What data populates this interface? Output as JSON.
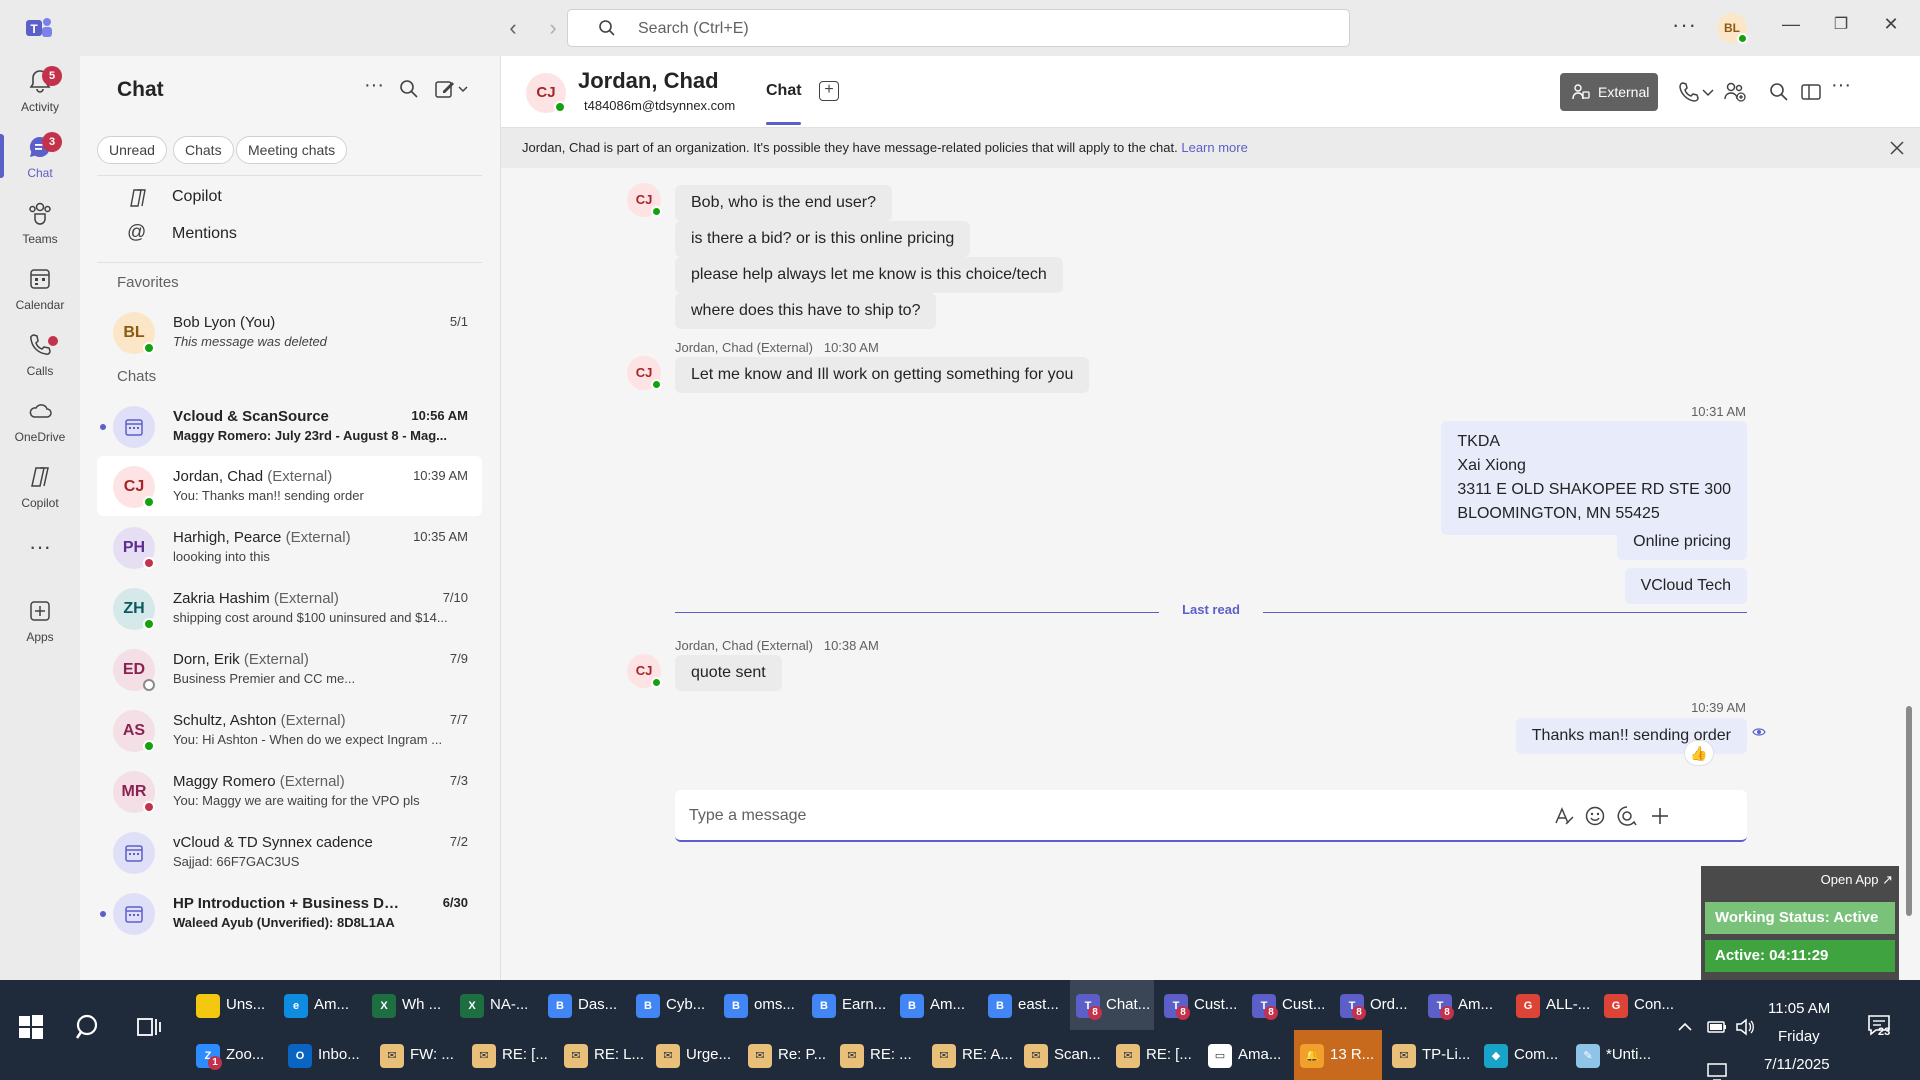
{
  "titlebar": {
    "search_placeholder": "Search (Ctrl+E)",
    "avatar_initials": "BL"
  },
  "rail": {
    "items": [
      {
        "label": "Activity",
        "badge": "5"
      },
      {
        "label": "Chat",
        "badge": "3"
      },
      {
        "label": "Teams"
      },
      {
        "label": "Calendar"
      },
      {
        "label": "Calls"
      },
      {
        "label": "OneDrive"
      },
      {
        "label": "Copilot"
      },
      {
        "label": "Apps"
      }
    ]
  },
  "chatlist": {
    "title": "Chat",
    "filters": [
      "Unread",
      "Chats",
      "Meeting chats"
    ],
    "links": [
      "Copilot",
      "Mentions"
    ],
    "favorites_label": "Favorites",
    "chats_label": "Chats",
    "favorites": [
      {
        "initials": "BL",
        "name": "Bob Lyon (You)",
        "preview": "This message was deleted",
        "time": "5/1"
      }
    ],
    "chats": [
      {
        "name": "Vcloud & ScanSource",
        "preview": "Maggy Romero: July 23rd - August 8 - Mag...",
        "time": "10:56 AM",
        "unread": true,
        "meeting": true
      },
      {
        "initials": "CJ",
        "name": "Jordan, Chad",
        "ext": "(External)",
        "preview": "You: Thanks man!! sending order",
        "time": "10:39 AM"
      },
      {
        "initials": "PH",
        "name": "Harhigh, Pearce",
        "ext": "(External)",
        "preview": "loooking into this",
        "time": "10:35 AM"
      },
      {
        "initials": "ZH",
        "name": "Zakria Hashim",
        "ext": "(External)",
        "preview": "shipping cost around $100 uninsured and $14...",
        "time": "7/10"
      },
      {
        "initials": "ED",
        "name": "Dorn, Erik",
        "ext": "(External)",
        "preview": "Business Premier and CC me...",
        "time": "7/9"
      },
      {
        "initials": "AS",
        "name": "Schultz, Ashton",
        "ext": "(External)",
        "preview": "You: Hi Ashton -  When do we expect Ingram ...",
        "time": "7/7"
      },
      {
        "initials": "MR",
        "name": "Maggy Romero",
        "ext": "(External)",
        "preview": "You: Maggy we are waiting for the VPO pls",
        "time": "7/3"
      },
      {
        "name": "vCloud & TD Synnex cadence",
        "preview": "Sajjad: 66F7GAC3US",
        "time": "7/2",
        "meeting": true
      },
      {
        "name": "HP Introduction + Business Dis...",
        "preview": "Waleed Ayub (Unverified): 8D8L1AA",
        "time": "6/30",
        "unread": true,
        "meeting": true
      }
    ]
  },
  "header": {
    "initials": "CJ",
    "name": "Jordan, Chad",
    "email": "t484086m@tdsynnex.com",
    "tab": "Chat",
    "external_label": "External"
  },
  "notice": {
    "text": "Jordan, Chad is part of an organization. It's possible they have message-related policies that will apply to the chat. ",
    "link": "Learn more"
  },
  "messages": {
    "incoming_1": [
      "Bob, who is the end user?",
      "is there a bid? or is this online pricing",
      "please help always let me know is this choice/tech",
      "where does this have to ship to?"
    ],
    "meta_2": "Jordan, Chad (External)   10:30 AM",
    "incoming_2": "Let me know and Ill work on getting something for you",
    "out_time_1": "10:31 AM",
    "address": [
      "TKDA",
      "Xai Xiong",
      "3311 E OLD SHAKOPEE RD STE 300",
      "BLOOMINGTON, MN 55425"
    ],
    "out_2": "Online pricing",
    "out_3": "VCloud Tech",
    "last_read": "Last read",
    "meta_3": "Jordan, Chad (External)   10:38 AM",
    "incoming_3": "quote sent",
    "out_time_2": "10:39 AM",
    "out_4": "Thanks man!! sending order",
    "reaction": "👍"
  },
  "compose": {
    "placeholder": "Type a message"
  },
  "widget": {
    "open_app": "Open App ↗",
    "status": "Working Status: Active",
    "active": "Active: 04:11:29"
  },
  "taskbar": {
    "row1": [
      {
        "label": "Uns...",
        "color": "#f2c811",
        "glyph": ""
      },
      {
        "label": "Am...",
        "color": "#0f8be0",
        "glyph": "e"
      },
      {
        "label": "Wh ...",
        "color": "#1d6f42",
        "glyph": "X"
      },
      {
        "label": "NA-...",
        "color": "#1d6f42",
        "glyph": "X"
      },
      {
        "label": "Das...",
        "color": "#4285f4",
        "glyph": "B"
      },
      {
        "label": "Cyb...",
        "color": "#4285f4",
        "glyph": "B"
      },
      {
        "label": "oms...",
        "color": "#4285f4",
        "glyph": "B"
      },
      {
        "label": "Earn...",
        "color": "#4285f4",
        "glyph": "B"
      },
      {
        "label": "Am...",
        "color": "#4285f4",
        "glyph": "B"
      },
      {
        "label": "east...",
        "color": "#4285f4",
        "glyph": "B"
      },
      {
        "label": "Chat...",
        "color": "#5b5fc7",
        "glyph": "T",
        "badge": "8",
        "active": true
      },
      {
        "label": "Cust...",
        "color": "#5b5fc7",
        "glyph": "T",
        "badge": "8"
      },
      {
        "label": "Cust...",
        "color": "#5b5fc7",
        "glyph": "T",
        "badge": "8"
      },
      {
        "label": "Ord...",
        "color": "#5b5fc7",
        "glyph": "T",
        "badge": "8"
      },
      {
        "label": "Am...",
        "color": "#5b5fc7",
        "glyph": "T",
        "badge": "8"
      },
      {
        "label": "ALL-...",
        "color": "#db4437",
        "glyph": "G"
      },
      {
        "label": "Con...",
        "color": "#db4437",
        "glyph": "G"
      }
    ],
    "row2": [
      {
        "label": "Zoo...",
        "color": "#2d8cff",
        "glyph": "Z",
        "badge": "1"
      },
      {
        "label": "Inbo...",
        "color": "#0a64c2",
        "glyph": "O"
      },
      {
        "label": "FW: ...",
        "color": "#e8c07a",
        "glyph": "✉"
      },
      {
        "label": "RE: [...",
        "color": "#e8c07a",
        "glyph": "✉"
      },
      {
        "label": "RE: L...",
        "color": "#e8c07a",
        "glyph": "✉"
      },
      {
        "label": "Urge...",
        "color": "#e8c07a",
        "glyph": "✉"
      },
      {
        "label": "Re: P...",
        "color": "#e8c07a",
        "glyph": "✉"
      },
      {
        "label": "RE: ...",
        "color": "#e8c07a",
        "glyph": "✉"
      },
      {
        "label": "RE: A...",
        "color": "#e8c07a",
        "glyph": "✉"
      },
      {
        "label": "Scan...",
        "color": "#e8c07a",
        "glyph": "✉"
      },
      {
        "label": "RE: [...",
        "color": "#e8c07a",
        "glyph": "✉"
      },
      {
        "label": "Ama...",
        "color": "#ffffff",
        "glyph": "▭"
      },
      {
        "label": "13 R...",
        "color": "#f2a02c",
        "glyph": "🔔",
        "alert": true
      },
      {
        "label": "TP-Li...",
        "color": "#e8c07a",
        "glyph": "✉"
      },
      {
        "label": "Com...",
        "color": "#1aa3c8",
        "glyph": "◆"
      },
      {
        "label": "*Unti...",
        "color": "#8fc3e8",
        "glyph": "✎"
      }
    ],
    "clock_time": "11:05 AM",
    "clock_day": "Friday",
    "clock_date": "7/11/2025",
    "notif_count": "23"
  }
}
